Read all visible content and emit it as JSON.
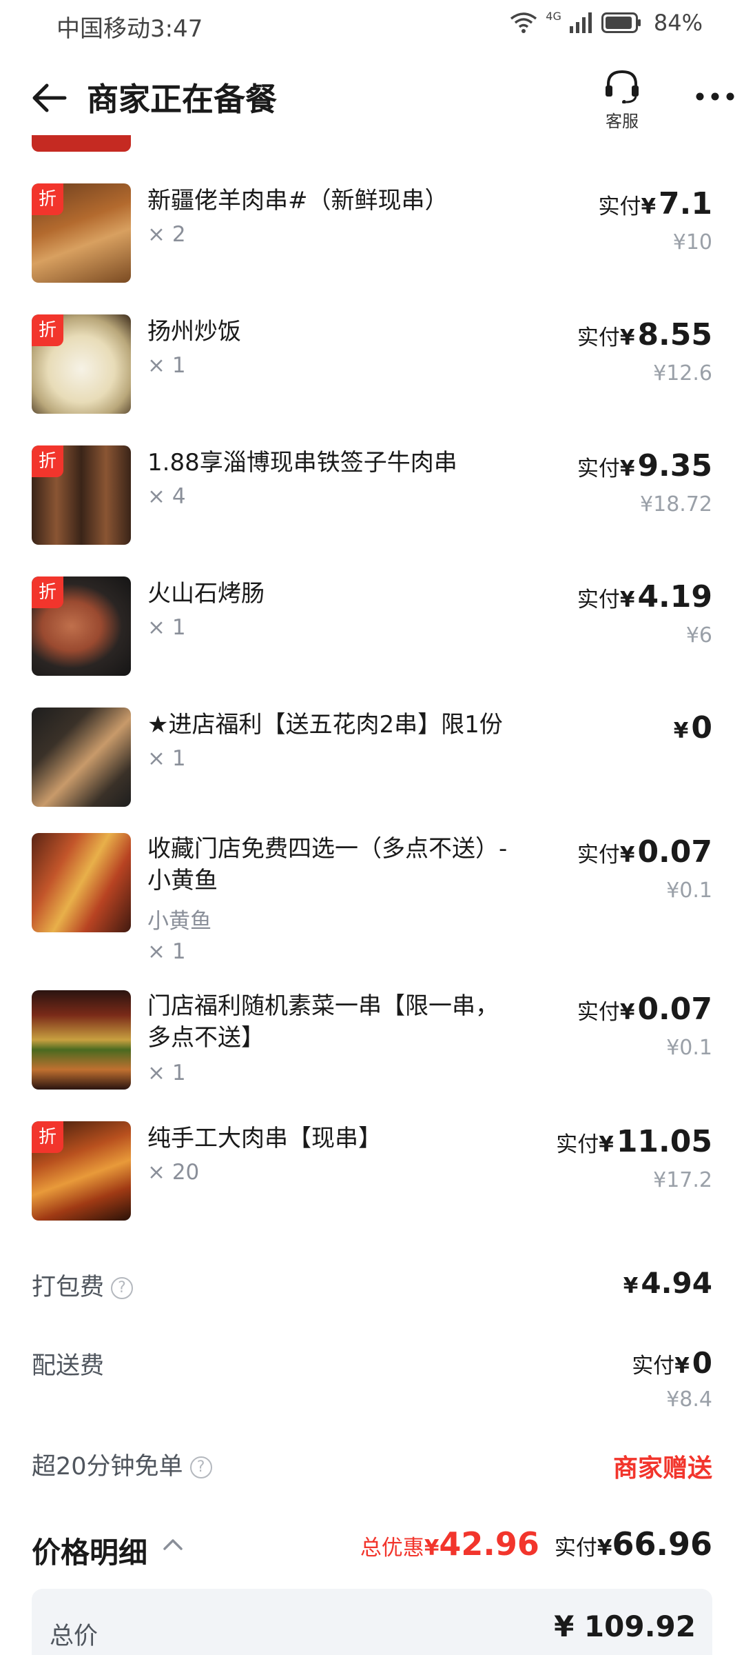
{
  "status_bar": {
    "carrier_time": "中国移动3:47",
    "network": "4G",
    "battery": "84%"
  },
  "header": {
    "title": "商家正在备餐",
    "customer_service": "客服"
  },
  "discount_badge": "折",
  "pay_prefix": "实付",
  "currency": "¥",
  "items": [
    {
      "name": "新疆佬羊肉串#（新鲜现串）",
      "line2": "",
      "sub": "",
      "qty": "× 2",
      "pay": "7.1",
      "orig": "¥10",
      "badge": true
    },
    {
      "name": "扬州炒饭",
      "line2": "",
      "sub": "",
      "qty": "× 1",
      "pay": "8.55",
      "orig": "¥12.6",
      "badge": true
    },
    {
      "name": "1.88享淄博现串铁签子牛肉串",
      "line2": "",
      "sub": "",
      "qty": "× 4",
      "pay": "9.35",
      "orig": "¥18.72",
      "badge": true
    },
    {
      "name": "火山石烤肠",
      "line2": "",
      "sub": "",
      "qty": "× 1",
      "pay": "4.19",
      "orig": "¥6",
      "badge": true
    },
    {
      "name": "★进店福利【送五花肉2串】限1份",
      "line2": "",
      "sub": "",
      "qty": "× 1",
      "pay": "0",
      "orig": "",
      "badge": false
    },
    {
      "name": "收藏门店免费四选一（多点不送）-",
      "line2": "小黄鱼",
      "sub": "小黄鱼",
      "qty": "× 1",
      "pay": "0.07",
      "orig": "¥0.1",
      "badge": false
    },
    {
      "name": "门店福利随机素菜一串【限一串，",
      "line2": "多点不送】",
      "sub": "",
      "qty": "× 1",
      "pay": "0.07",
      "orig": "¥0.1",
      "badge": false
    },
    {
      "name": "纯手工大肉串【现串】",
      "line2": "",
      "sub": "",
      "qty": "× 20",
      "pay": "11.05",
      "orig": "¥17.2",
      "badge": true
    }
  ],
  "fees": {
    "packing_label": "打包费",
    "packing_value": "4.94",
    "delivery_label": "配送费",
    "delivery_value": "0",
    "delivery_orig": "¥8.4",
    "late_label": "超20分钟免单",
    "late_value": "商家赠送"
  },
  "price_detail": {
    "label": "价格明细",
    "discount_label": "总优惠",
    "discount_value": "42.96",
    "paid_value": "66.96",
    "total_label": "总价",
    "total_value": "¥ 109.92"
  },
  "colors": {
    "accent_red": "#f2352c",
    "muted_text": "#8a8f99",
    "panel_bg": "#f2f4f7"
  }
}
